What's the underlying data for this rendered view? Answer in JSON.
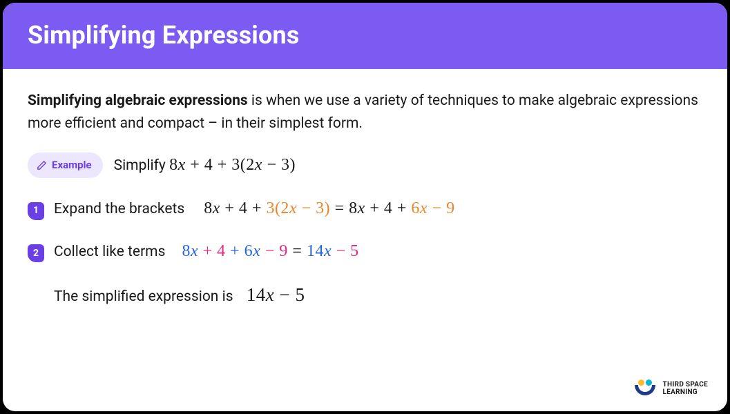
{
  "header": {
    "title": "Simplifying Expressions"
  },
  "intro": {
    "bold": "Simplifying algebraic expressions",
    "rest": " is when we use a variety of techniques to make algebraic expressions more efficient and compact – in their simplest form."
  },
  "example": {
    "badge": "Example",
    "label": "Simplify ",
    "expr": {
      "a": "8",
      "b": " + 4 + 3(2",
      "c": " − 3)"
    }
  },
  "step1": {
    "num": "1",
    "label": "Expand the brackets",
    "lhs": {
      "a": "8",
      "b": " + 4 + ",
      "o1": "3(2",
      "o1x": "x",
      "o2": " − 3)"
    },
    "eq": " = ",
    "rhs": {
      "a": "8",
      "b": " + 4 + ",
      "o1": "6",
      "o2": " − 9"
    }
  },
  "step2": {
    "num": "2",
    "label": "Collect like terms",
    "lhs": {
      "b1": "8",
      "p1": " + 4 ",
      "b2": "+ 6",
      "p2": " − 9"
    },
    "eq": " = ",
    "rhs": {
      "b": "14",
      "p": " − 5"
    }
  },
  "result": {
    "label": "The simplified expression is",
    "expr": {
      "a": "14",
      "b": " − 5"
    }
  },
  "logo": {
    "l1": "THIRD SPACE",
    "l2": "LEARNING"
  }
}
